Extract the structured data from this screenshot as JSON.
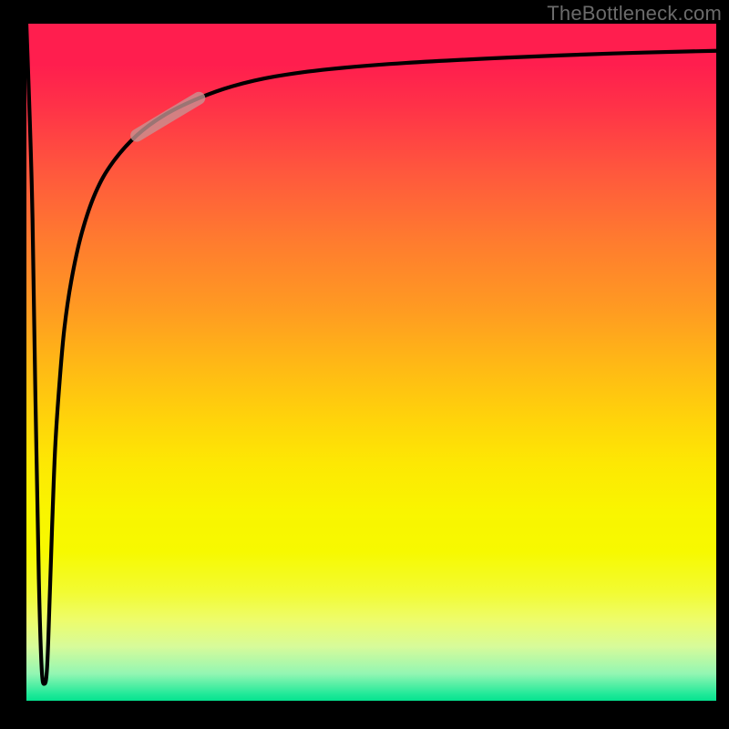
{
  "attribution": "TheBottleneck.com",
  "chart_data": {
    "type": "line",
    "title": "",
    "xlabel": "",
    "ylabel": "",
    "x_range": [
      0,
      100
    ],
    "y_range": [
      0,
      100
    ],
    "series": [
      {
        "name": "curve",
        "x": [
          0.0,
          0.8,
          1.3,
          1.8,
          2.2,
          2.6,
          3.0,
          3.4,
          3.8,
          4.2,
          4.8,
          5.5,
          6.5,
          8.0,
          10.0,
          12.5,
          16.0,
          20.0,
          25.0,
          30.0,
          36.0,
          44.0,
          55.0,
          70.0,
          85.0,
          100.0
        ],
        "y": [
          100.0,
          75.0,
          45.0,
          18.0,
          5.0,
          2.5,
          5.0,
          16.0,
          28.0,
          38.0,
          47.0,
          55.0,
          62.0,
          69.0,
          75.0,
          79.5,
          83.5,
          86.5,
          89.0,
          90.8,
          92.2,
          93.3,
          94.2,
          95.0,
          95.6,
          96.0
        ]
      },
      {
        "name": "overlay-segment",
        "x": [
          16.0,
          25.0
        ],
        "y": [
          83.5,
          89.0
        ]
      }
    ],
    "gradient_stops": [
      {
        "pos": 0.0,
        "color": "#ff1e4e"
      },
      {
        "pos": 0.5,
        "color": "#ffb716"
      },
      {
        "pos": 0.78,
        "color": "#f7f900"
      },
      {
        "pos": 1.0,
        "color": "#05e38f"
      }
    ]
  }
}
